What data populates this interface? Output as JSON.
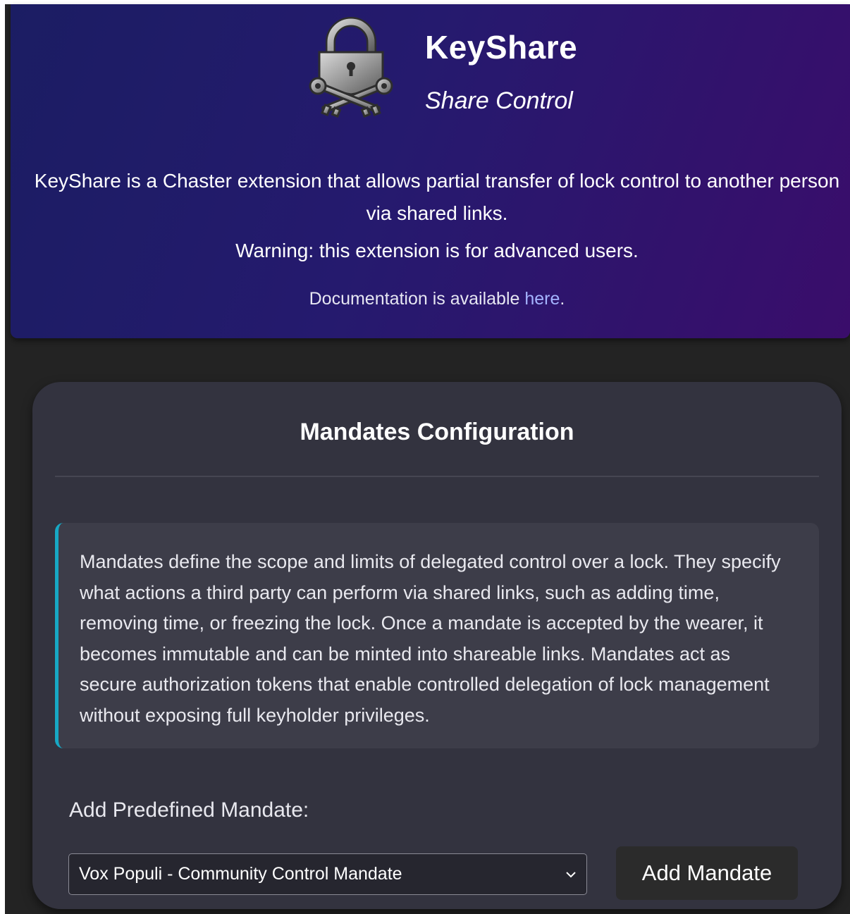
{
  "app": {
    "title": "KeyShare",
    "subtitle": "Share Control",
    "logo_icon": "padlock-crossed-keys-icon"
  },
  "header": {
    "description": "KeyShare is a Chaster extension that allows partial transfer of lock control to another person via shared links.",
    "warning": "Warning: this extension is for advanced users.",
    "docs_prefix": "Documentation is available ",
    "docs_link": "here",
    "docs_suffix": "."
  },
  "mandates": {
    "title": "Mandates Configuration",
    "info": "Mandates define the scope and limits of delegated control over a lock. They specify what actions a third party can perform via shared links, such as adding time, removing time, or freezing the lock. Once a mandate is accepted by the wearer, it becomes immutable and can be minted into shareable links. Mandates act as secure authorization tokens that enable controlled delegation of lock management without exposing full keyholder privileges.",
    "predefined_label": "Add Predefined Mandate:",
    "selected_option": "Vox Populi - Community Control Mandate",
    "add_button": "Add Mandate"
  },
  "colors": {
    "header_gradient_start": "#1b1d63",
    "header_gradient_end": "#3a0d6b",
    "card_bg": "#33333f",
    "info_accent": "#17a8c4",
    "link": "#a5b4ff"
  }
}
